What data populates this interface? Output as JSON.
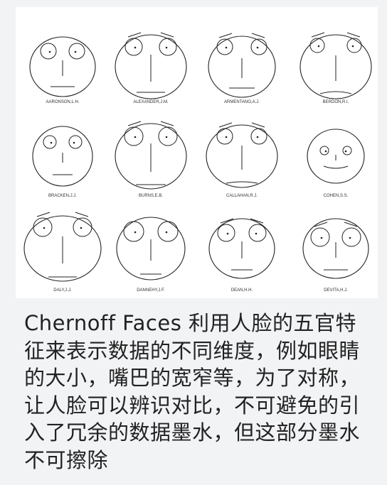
{
  "figure": {
    "faces": [
      {
        "name": "AARONSON,L.H.",
        "eyes": "small"
      },
      {
        "name": "ALEXANDER,J.M.",
        "eyes": "large-brows"
      },
      {
        "name": "ARMENTANO,A.J.",
        "eyes": "medium-brows"
      },
      {
        "name": "BERDON,R.I.",
        "eyes": "small-brows"
      },
      {
        "name": "BRACKEN,J.J.",
        "eyes": "small"
      },
      {
        "name": "BURNS,E.B.",
        "eyes": "large-brows"
      },
      {
        "name": "CALLAHAN,R.J.",
        "eyes": "medium-brows"
      },
      {
        "name": "COHEN,S.S.",
        "eyes": "small"
      },
      {
        "name": "DALY,J.J.",
        "eyes": "large-brows"
      },
      {
        "name": "DANNEHY,J.F.",
        "eyes": "large"
      },
      {
        "name": "DEAN,H.H.",
        "eyes": "medium-brows"
      },
      {
        "name": "DEVITA,H.J.",
        "eyes": "large-brows"
      }
    ]
  },
  "caption": {
    "text": "Chernoff Faces 利用人脸的五官特征来表示数据的不同维度，例如眼睛的大小，嘴巴的宽窄等，为了对称，让人脸可以辨识对比，不可避免的引入了冗余的数据墨水，但这部分墨水不可擦除"
  },
  "colors": {
    "background": "#f2f3f5",
    "panel": "#ffffff",
    "ink": "#222222"
  }
}
